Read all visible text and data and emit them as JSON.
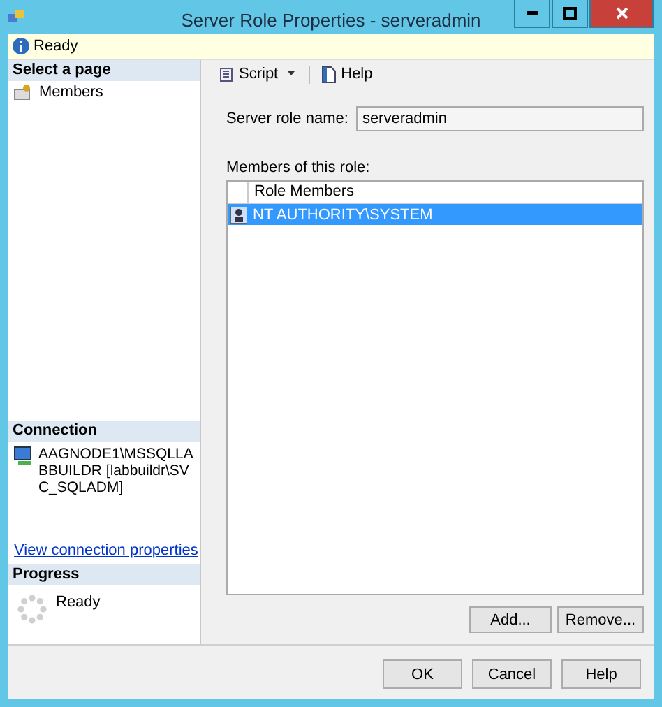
{
  "window": {
    "title": "Server Role Properties - serveradmin"
  },
  "info_bar": {
    "text": "Ready"
  },
  "sidebar": {
    "select_page": {
      "heading": "Select a page",
      "items": [
        {
          "label": "Members"
        }
      ]
    },
    "connection": {
      "heading": "Connection",
      "server": "AAGNODE1\\MSSQLLABBUILDR [labbuildr\\SVC_SQLADM]",
      "link": "View connection properties"
    },
    "progress": {
      "heading": "Progress",
      "status": "Ready"
    }
  },
  "toolbar": [
    {
      "label": "Script",
      "kind": "dropdown"
    },
    {
      "label": "Help",
      "kind": "button"
    }
  ],
  "server_role_name": {
    "label": "Server role name:",
    "value": "serveradmin"
  },
  "members": {
    "label": "Members of this role:",
    "columns": [
      "Role Members"
    ],
    "rows": [
      {
        "name": "NT AUTHORITY\\SYSTEM",
        "selected": true
      }
    ]
  },
  "member_buttons": [
    "Add...",
    "Remove..."
  ],
  "buttons": [
    "OK",
    "Cancel",
    "Help"
  ]
}
